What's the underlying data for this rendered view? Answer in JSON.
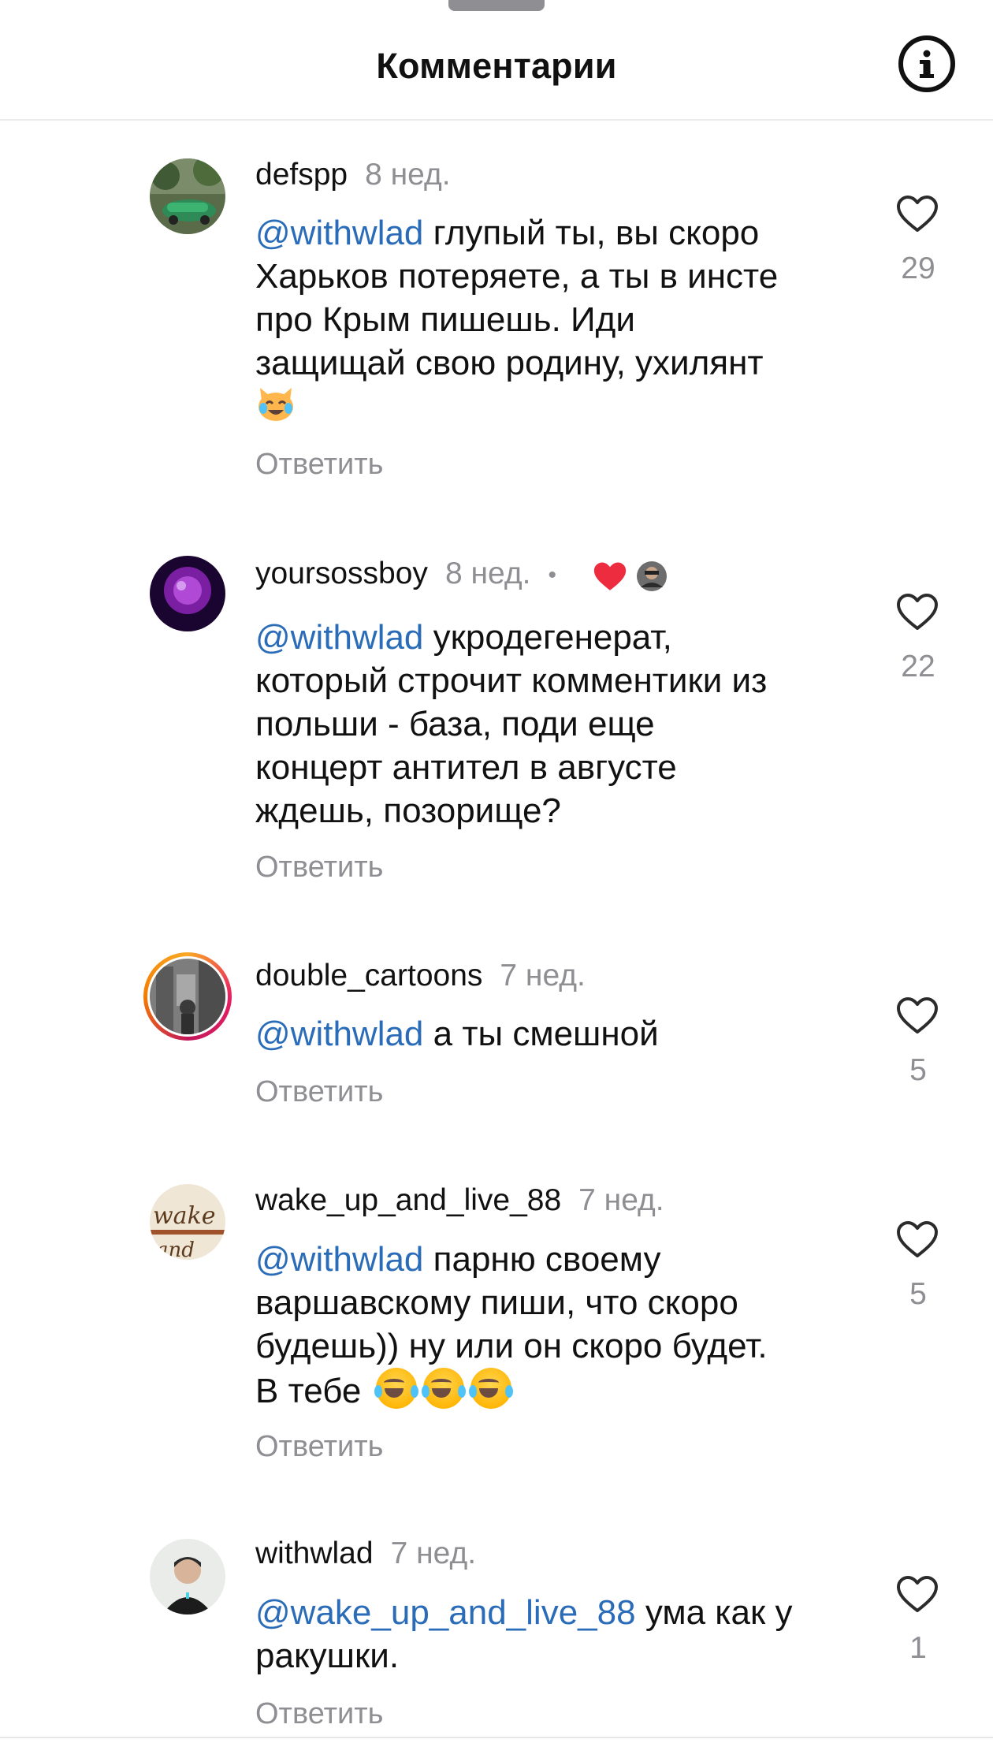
{
  "header": {
    "title": "Комментарии"
  },
  "reply_label": "Ответить",
  "comments": [
    {
      "username": "defspp",
      "time": "8 нед.",
      "mention": "@withwlad",
      "text_lines": [
        "глупый ты, вы скоро",
        "Харьков потеряете, а ты в инсте",
        "про Крым пишешь. Иди",
        "защищай свою родину, ухилянт"
      ],
      "emoji": "crying-laughing-cat",
      "likes": "29"
    },
    {
      "username": "yoursossboy",
      "time": "8 нед.",
      "liked_by_author": true,
      "mention": "@withwlad",
      "text_lines": [
        "укродегенерат,",
        "который строчит комментики из",
        "польши - база, поди еще",
        "концерт антител в августе",
        "ждешь, позорище?"
      ],
      "likes": "22"
    },
    {
      "username": "double_cartoons",
      "time": "7 нед.",
      "mention": "@withwlad",
      "text_lines": [
        "а ты смешной"
      ],
      "likes": "5"
    },
    {
      "username": "wake_up_and_live_88",
      "time": "7 нед.",
      "mention": "@withwlad",
      "text_lines": [
        "парню своему",
        "варшавскому пиши, что скоро",
        "будешь)) ну или он скоро будет.",
        "В тебе"
      ],
      "emoji": "face-with-tears-of-joy x3",
      "likes": "5"
    },
    {
      "username": "withwlad",
      "time": "7 нед.",
      "mention": "@wake_up_and_live_88",
      "text_lines": [
        "ума как у",
        "ракушки."
      ],
      "likes": "1"
    }
  ],
  "colors": {
    "mention": "#2b6cb8",
    "secondary_text": "#8e8e93",
    "heart_liked": "#ed2c3f"
  }
}
